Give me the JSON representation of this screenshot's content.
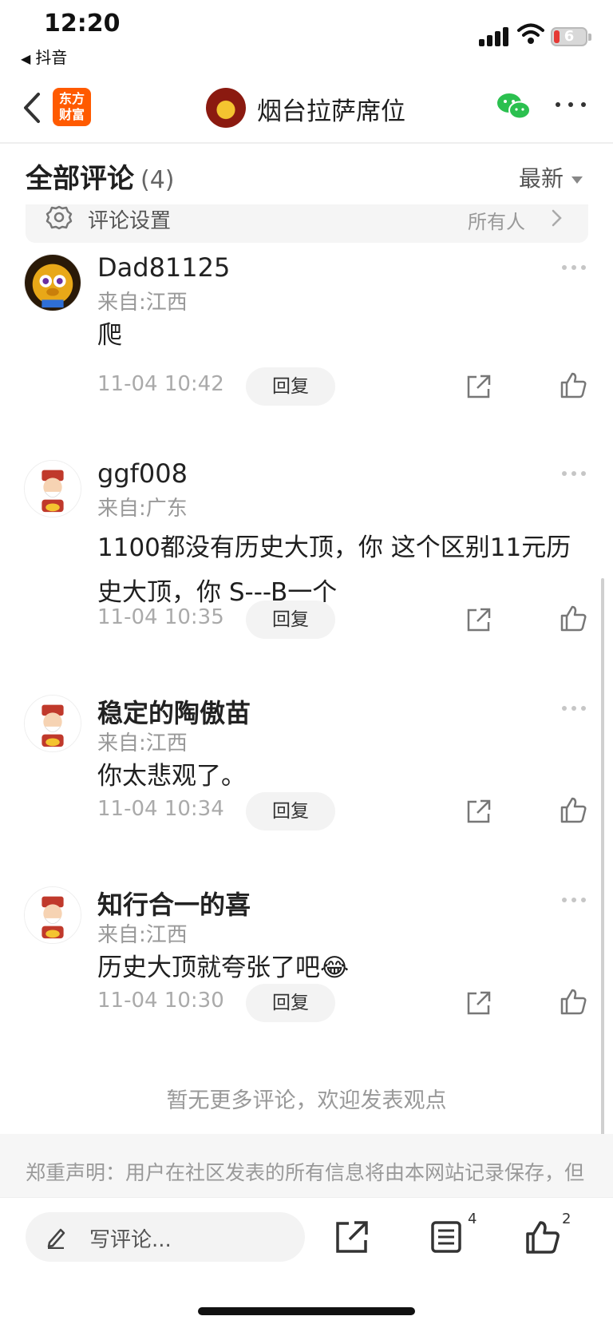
{
  "status_bar": {
    "time": "12:20",
    "back_app": "抖音",
    "battery": "6"
  },
  "header": {
    "app_logo_line1": "东方",
    "app_logo_line2": "财富",
    "title": "烟台拉萨席位"
  },
  "comments_section": {
    "title": "全部评论",
    "count": "(4)",
    "sort_label": "最新",
    "settings_label": "评论设置",
    "settings_value": "所有人"
  },
  "comments": [
    {
      "user": "Dad81125",
      "location": "来自:江西",
      "text": "爬",
      "time": "11-04 10:42",
      "reply": "回复"
    },
    {
      "user": "ggf008",
      "location": "来自:广东",
      "text": "1100都没有历史大顶，你 这个区别11元历史大顶，你 S---B一个",
      "time": "11-04 10:35",
      "reply": "回复"
    },
    {
      "user": "稳定的陶傲苗",
      "location": "来自:江西",
      "text": "你太悲观了。",
      "time": "11-04 10:34",
      "reply": "回复"
    },
    {
      "user": "知行合一的喜",
      "location": "来自:江西",
      "text": "历史大顶就夸张了吧😂",
      "time": "11-04 10:30",
      "reply": "回复"
    }
  ],
  "footer": {
    "no_more": "暂无更多评论，欢迎发表观点",
    "disclaimer": "郑重声明：用户在社区发表的所有信息将由本网站记录保存，但代表作者个人观点，与本网站立场无关，不对您构成"
  },
  "bottom_bar": {
    "write_placeholder": "写评论...",
    "comments_badge": "4",
    "likes_badge": "2"
  },
  "colors": {
    "accent_orange": "#ff5a00",
    "wechat_green": "#2bc04f"
  }
}
